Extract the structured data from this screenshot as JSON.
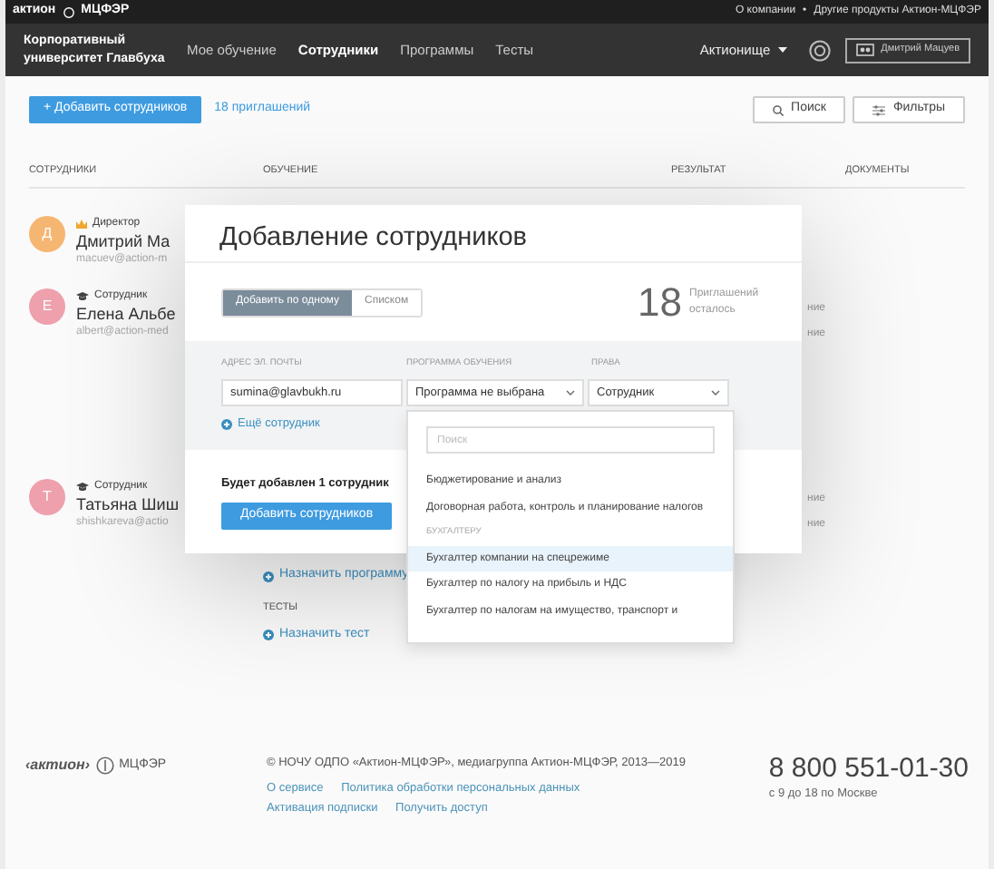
{
  "top_bar": {
    "logo": "актион",
    "logo_sub": "МЦФЭР",
    "links": [
      "О компании",
      "Другие продукты Актион-МЦФЭР"
    ],
    "separator": "•"
  },
  "nav": {
    "brand": "Корпоративный университет Главбуха",
    "items": [
      {
        "label": "Мое обучение",
        "selected": false
      },
      {
        "label": "Сотрудники",
        "selected": true
      },
      {
        "label": "Программы",
        "selected": false
      },
      {
        "label": "Тесты",
        "selected": false
      }
    ],
    "dropdown": "Актионище",
    "user": "Дмитрий Мацуев"
  },
  "actions": {
    "add_button": "+ Добавить сотрудников",
    "invites_link": "18 приглашений",
    "search_button": "Поиск",
    "filter_button": "Фильтры"
  },
  "table": {
    "columns": [
      "СОТРУДНИКИ",
      "ОБУЧЕНИЕ",
      "РЕЗУЛЬТАТ",
      "ДОКУМЕНТЫ"
    ],
    "rows": [
      {
        "initial": "Д",
        "color": "#f5b672",
        "kind": "director",
        "role": "Директор",
        "name": "Дмитрий Ма",
        "email": "macuev@action-m",
        "training": []
      },
      {
        "initial": "Е",
        "color": "#eea0ad",
        "kind": "employee",
        "role": "Сотрудник",
        "name": "Елена Альбе",
        "email": "albert@action-med",
        "training": [
          "ние",
          "ние"
        ]
      },
      {
        "initial": "Т",
        "color": "#eea0ad",
        "kind": "employee",
        "role": "Сотрудник",
        "name": "Татьяна Шиш",
        "email": "shishkareva@actio",
        "training": [
          "ние",
          "ние"
        ],
        "assign_program": "Назначить программу",
        "tests_label": "ТЕСТЫ",
        "assign_test": "Назначить тест"
      }
    ]
  },
  "modal": {
    "title": "Добавление сотрудников",
    "modes": [
      {
        "label": "Добавить по одному",
        "selected": true
      },
      {
        "label": "Списком",
        "selected": false
      }
    ],
    "invites_count": "18",
    "invites_text": "Приглашений осталось",
    "email_label": "АДРЕС ЭЛ. ПОЧТЫ",
    "email_value": "sumina@glavbukh.ru",
    "program_label": "ПРОГРАММА ОБУЧЕНИЯ",
    "program_value": "Программа не выбрана",
    "rights_label": "ПРАВА",
    "rights_value": "Сотрудник",
    "more_link": "Ещё сотрудник",
    "summary": "Будет добавлен 1 сотрудник",
    "submit": "Добавить сотрудников",
    "dropdown": {
      "placeholder": "Поиск",
      "items": [
        {
          "kind": "option",
          "label": "Бюджетирование и анализ",
          "selected": false
        },
        {
          "kind": "option",
          "label": "Договорная работа, контроль и планирование налогов",
          "selected": false
        },
        {
          "kind": "group",
          "label": "БУХГАЛТЕРУ"
        },
        {
          "kind": "option",
          "label": "Бухгалтер компании на спецрежиме",
          "selected": true
        },
        {
          "kind": "option",
          "label": "Бухгалтер по налогу на прибыль и НДС",
          "selected": false
        },
        {
          "kind": "option",
          "label": "Бухгалтер по налогам на имущество, транспорт и",
          "selected": false
        }
      ]
    }
  },
  "footer": {
    "logo": "‹актион›",
    "logo_sub": "МЦФЭР",
    "copyright": "© НОЧУ ОДПО «Актион-МЦФЭР», медиагруппа Актион-МЦФЭР, 2013—2019",
    "links": [
      "О сервисе",
      "Политика обработки персональных данных",
      "Активация подписки",
      "Получить доступ"
    ],
    "phone": "8 800 551-01-30",
    "hours": "с 9 до 18 по Москве"
  }
}
